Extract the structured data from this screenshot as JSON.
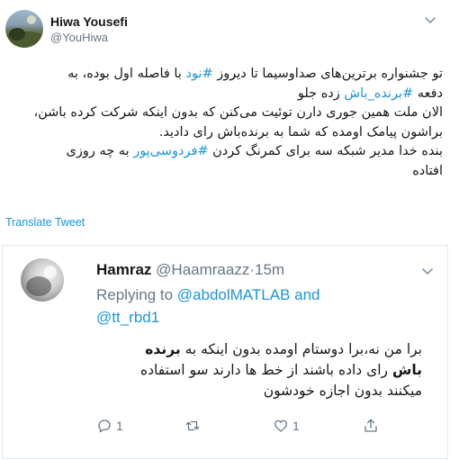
{
  "author": {
    "name": "Hiwa Yousefi",
    "handle": "@YouHiwa"
  },
  "tweet": {
    "line1": {
      "pre": "تو جشنواره برترین‌های صداوسیما تا دیروز ",
      "tag": "#نود",
      "post": " با فاصله اول بوده، به"
    },
    "line2": {
      "pre": "دفعه ",
      "tag": "#برنده_باش",
      "post": " زده جلو"
    },
    "line3": "الان ملت همین جوری دارن توئیت می‌کنن که بدون اینکه شرکت کرده باشن،",
    "line4": "براشون پیامک اومده که شما به برنده‌باش رای دادید.",
    "line5": {
      "pre": "بنده خدا مدیر شبکه سه برای کمرنگ کردن ",
      "tag": "#فردوسی‌پور",
      "post": " به چه روزی"
    },
    "line6": "افتاده"
  },
  "translate_label": "Translate Tweet",
  "reply": {
    "name": "Hamraz",
    "handle": "@Haamraazz",
    "dot": "·",
    "time": "15m",
    "replying_prefix": "Replying to ",
    "mention1": "@abdolMATLAB",
    "and": " and",
    "mention2": "@tt_rbd1",
    "body": {
      "line1_pre": "برا من نه،برا دوستام اومده بدون اینکه به ",
      "line1_bold": "برنده",
      "line2_bold": "باش",
      "line2_post": " رای داده باشند از خط ها دارند سو استفاده",
      "line3": "میکنند بدون اجازه خودشون"
    },
    "actions": {
      "reply_count": "1",
      "retweet_count": "",
      "like_count": "1"
    }
  },
  "icons": {
    "more": "chevron-down-icon",
    "reply": "reply-icon",
    "retweet": "retweet-icon",
    "like": "heart-icon",
    "share": "share-icon"
  },
  "colors": {
    "link": "#1b95e0",
    "muted": "#657786",
    "text": "#14171a"
  }
}
